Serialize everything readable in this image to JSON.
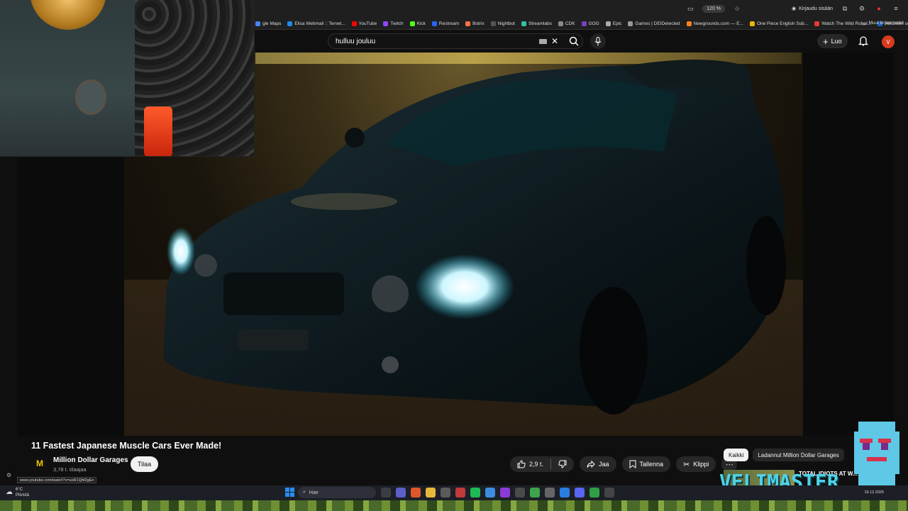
{
  "browser": {
    "zoom": "120 %",
    "signin_label": "Kirjaudu sisään",
    "bookmarks": [
      {
        "label": "gle Maps",
        "color": "#4285f4"
      },
      {
        "label": "Elisa Webmail :: Tervet...",
        "color": "#1e88e5"
      },
      {
        "label": "YouTube",
        "color": "#ff0000"
      },
      {
        "label": "Twitch",
        "color": "#9146ff"
      },
      {
        "label": "Kick",
        "color": "#53fc18"
      },
      {
        "label": "Restream",
        "color": "#2962ff"
      },
      {
        "label": "Botrix",
        "color": "#ff7043"
      },
      {
        "label": "Nightbot",
        "color": "#555555"
      },
      {
        "label": "Streamlabs",
        "color": "#31c3a2"
      },
      {
        "label": "CDK",
        "color": "#888888"
      },
      {
        "label": "GOG",
        "color": "#7b3fbf"
      },
      {
        "label": "Epic",
        "color": "#aaaaaa"
      },
      {
        "label": "Games | DEIDetected",
        "color": "#999999"
      },
      {
        "label": "Newgrounds.com — E...",
        "color": "#f5821f"
      },
      {
        "label": "One Piece English Sub...",
        "color": "#f0b400"
      },
      {
        "label": "Watch The Wild Robot...",
        "color": "#e53935"
      },
      {
        "label": "Aikuisten sosiaalipalve...",
        "color": "#1565c0"
      }
    ],
    "bookmarks_all": "Muut kirjanmerkit"
  },
  "youtube": {
    "search_value": "hulluu jouluu",
    "create_label": "Luo",
    "avatar_letter": "V"
  },
  "video": {
    "title": "11 Fastest Japanese Muscle Cars Ever Made!",
    "channel_logo_letter": "M",
    "channel_name": "Million Dollar Garages",
    "subscribers": "3,78 t. tilaajaa",
    "subscribe_label": "Tilaa",
    "likes": "2,9 t.",
    "share_label": "Jaa",
    "save_label": "Tallenna",
    "clip_label": "Klippi"
  },
  "recommendations": {
    "chips": [
      "Kaikki",
      "Ladannut Million Dollar Garages"
    ],
    "first_title": "TOTAL IDIOTS AT W..."
  },
  "status_url": "www.youtube.com/watch?v=uoR1Qfd2gEo",
  "overlay": {
    "brand": "VELIMASTER"
  },
  "taskbar": {
    "temperature": "6°C",
    "weather_text": "Pilvistä",
    "search_label": "Hae",
    "date": "19.12.2025"
  },
  "colors": {
    "accent_red": "#ff0000",
    "brand_cyan": "#4fd2e8"
  }
}
